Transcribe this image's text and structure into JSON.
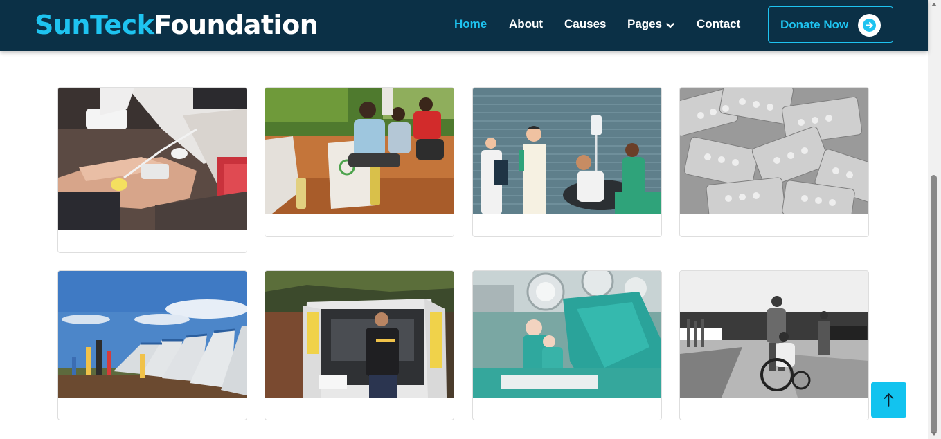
{
  "header": {
    "logo_part1": "SunTeck",
    "logo_part2": "Foundation",
    "nav": [
      "Home",
      "About",
      "Causes",
      "Pages",
      "Contact"
    ],
    "active_nav": "Home",
    "donate_label": "Donate Now"
  },
  "gallery": {
    "items": [
      {
        "subject": "blood donation"
      },
      {
        "subject": "food aid distribution"
      },
      {
        "subject": "medical staff illustration"
      },
      {
        "subject": "medicine blister packs"
      },
      {
        "subject": "relief tents camp"
      },
      {
        "subject": "ambulance rescue"
      },
      {
        "subject": "surgery operating room"
      },
      {
        "subject": "wheelchair athlete"
      }
    ]
  },
  "colors": {
    "header_bg": "#0b3046",
    "accent": "#1ec3f0",
    "back_to_top": "#12c3ef"
  },
  "icons": {
    "donate": "arrow-right-icon",
    "pages_menu": "chevron-down-icon",
    "back_to_top": "arrow-up-icon"
  }
}
